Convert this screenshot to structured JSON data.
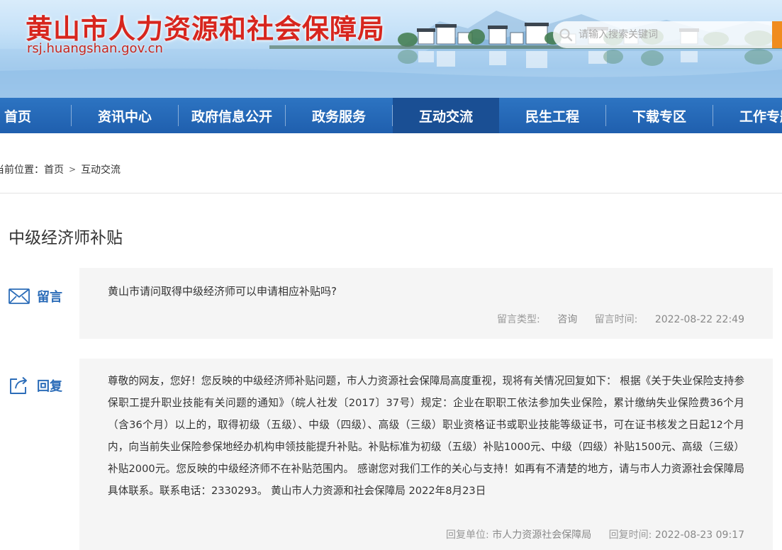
{
  "header": {
    "site_title": "黄山市人力资源和社会保障局",
    "site_domain": "rsj.huangshan.gov.cn",
    "search_placeholder": "请输入搜索关键词"
  },
  "nav": {
    "items": [
      "首页",
      "资讯中心",
      "政府信息公开",
      "政务服务",
      "互动交流",
      "民生工程",
      "下载专区",
      "工作专题"
    ],
    "active_index": 4
  },
  "breadcrumb": {
    "label": "当前位置：",
    "home": "首页",
    "separator": ">",
    "current": "互动交流"
  },
  "page": {
    "title": "中级经济师补贴"
  },
  "message": {
    "label": "留言",
    "text": "黄山市请问取得中级经济师可以申请相应补贴吗?",
    "type_label": "留言类型:",
    "type_value": "咨询",
    "time_label": "留言时间:",
    "time_value": "2022-08-22 22:49"
  },
  "reply": {
    "label": "回复",
    "text": "尊敬的网友，您好！您反映的中级经济师补贴问题，市人力资源社会保障局高度重视，现将有关情况回复如下： 根据《关于失业保险支持参保职工提升职业技能有关问题的通知》（皖人社发〔2017〕37号）规定：企业在职职工依法参加失业保险，累计缴纳失业保险费36个月（含36个月）以上的，取得初级（五级）、中级（四级）、高级（三级）职业资格证书或职业技能等级证书，可在证书核发之日起12个月内，向当前失业保险参保地经办机构申领技能提升补贴。补贴标准为初级（五级）补贴1000元、中级（四级）补贴1500元、高级（三级）补贴2000元。您反映的中级经济师不在补贴范围内。 感谢您对我们工作的关心与支持！如再有不清楚的地方，请与市人力资源社会保障局具体联系。联系电话：2330293。 黄山市人力资源和社会保障局 2022年8月23日",
    "unit_label": "回复单位:",
    "unit_value": "市人力资源社会保障局",
    "time_label": "回复时间:",
    "time_value": "2022-08-23 09:17"
  },
  "colors": {
    "title_red": "#d7261e",
    "nav_blue": "#2a6fbf",
    "nav_active": "#1a4f94",
    "label_blue": "#2b6cb8",
    "panel_bg": "#f5f5f5",
    "search_orange": "#f08c1e"
  }
}
